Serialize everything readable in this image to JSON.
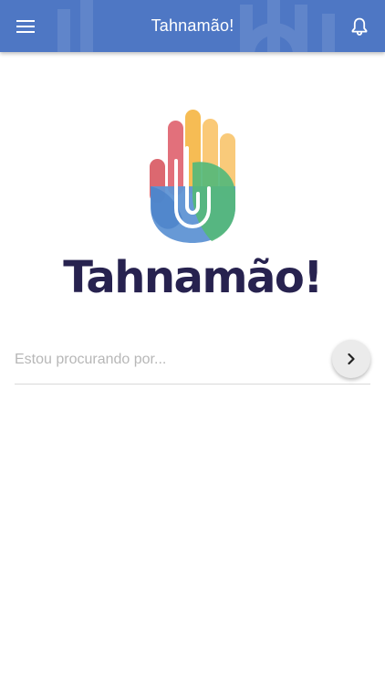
{
  "appbar": {
    "title": "Tahnamão!",
    "menu_icon": "hamburger-menu-icon",
    "notification_icon": "bell-icon",
    "color": "#4e77c4"
  },
  "brand": {
    "wordmark": "Tahnamão!",
    "wordmark_color": "#27224f",
    "logo_icon": "multicolor-hand-logo"
  },
  "search": {
    "placeholder": "Estou procurando por...",
    "value": "",
    "submit_icon": "chevron-right-icon"
  }
}
